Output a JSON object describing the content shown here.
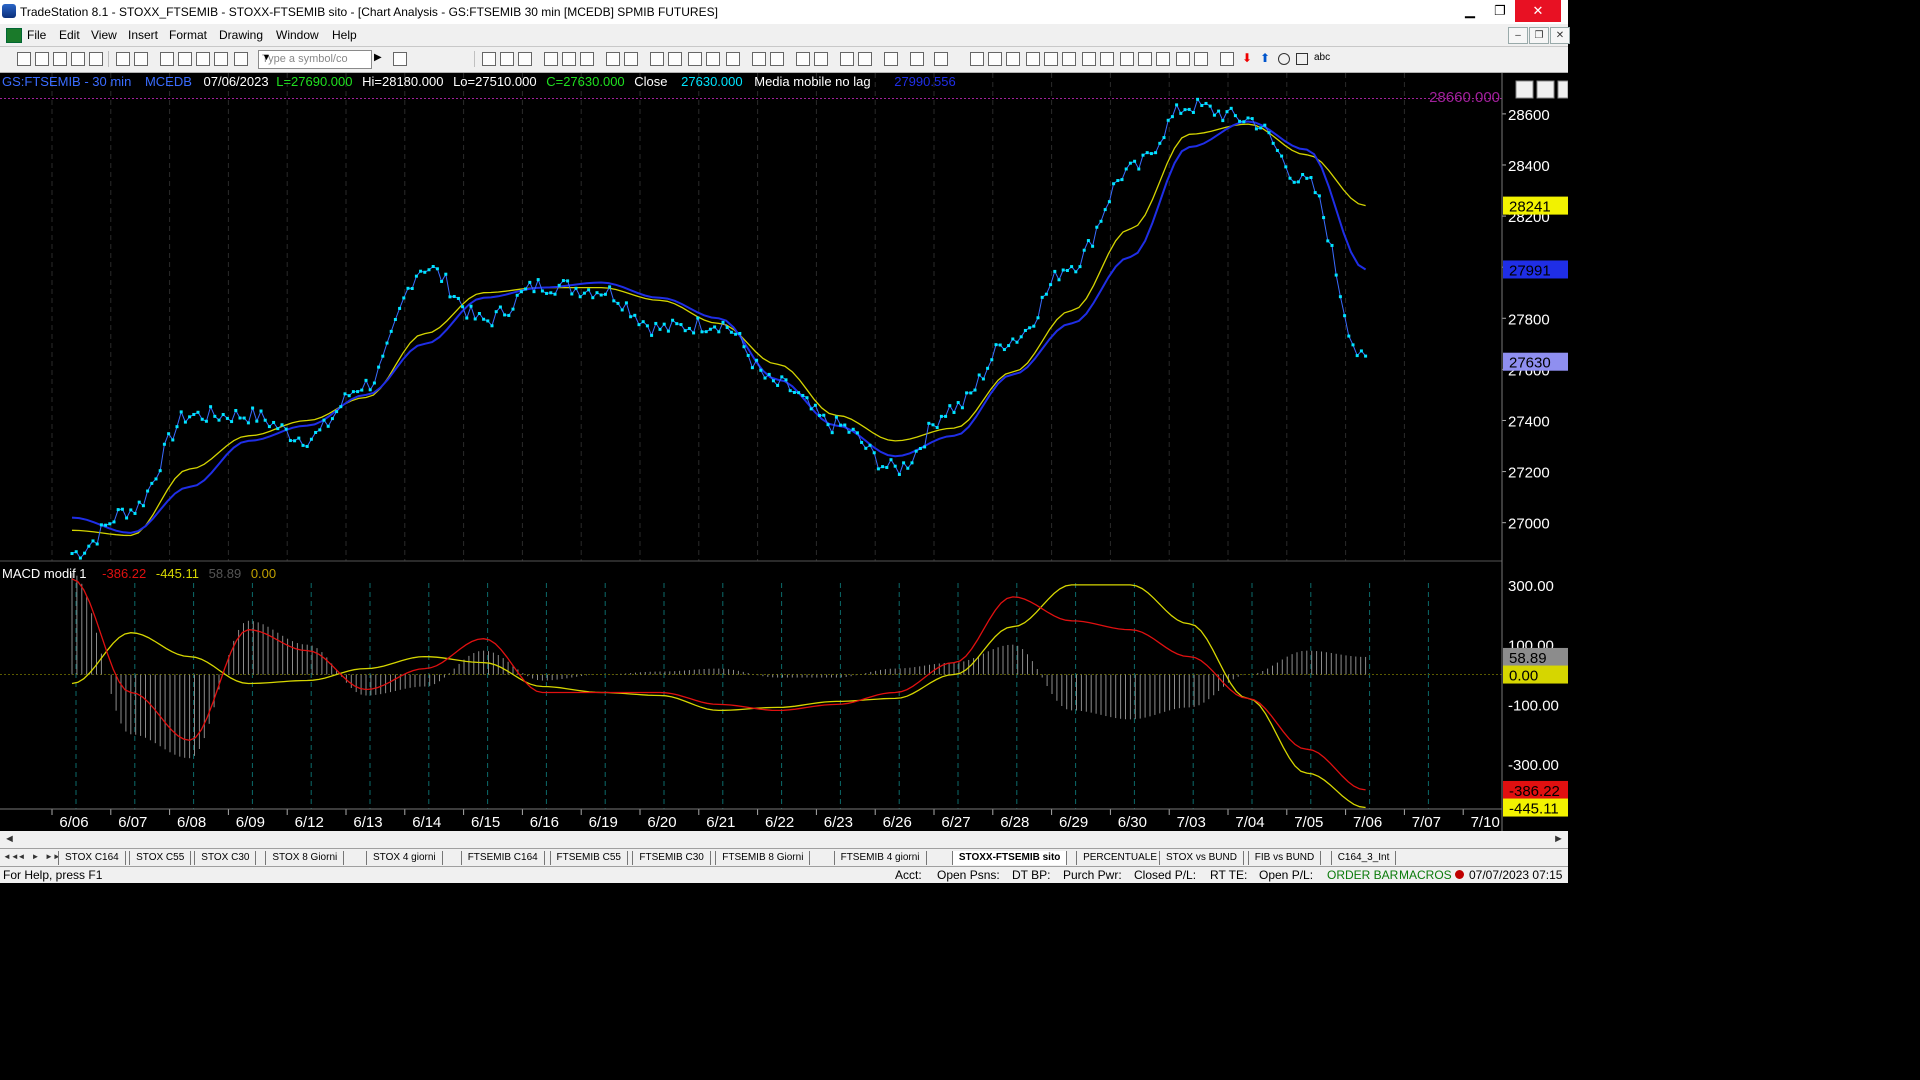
{
  "window": {
    "title": "TradeStation 8.1 - STOXX_FTSEMIB - STOXX-FTSEMIB sito - [Chart Analysis - GS:FTSEMIB  30 min  [MCEDB] SPMIB FUTURES]",
    "minimize": "▁",
    "maximize": "❐",
    "close": "✕"
  },
  "menu": {
    "items": [
      "File",
      "Edit",
      "View",
      "Insert",
      "Format",
      "Drawing",
      "Window",
      "Help"
    ],
    "mdi_buttons": [
      "–",
      "❐",
      "✕"
    ]
  },
  "toolbar": {
    "symbol_placeholder": "Type a symbol/co",
    "text_tool": "abc"
  },
  "chart": {
    "header": {
      "symbol": "GS:FTSEMIB - 30 min",
      "feed": "MCEDB",
      "date": "07/06/2023",
      "low_left": "L=27690.000",
      "high": "Hi=28180.000",
      "low": "Lo=27510.000",
      "close_eq": "C=27630.000",
      "close_label": "Close",
      "close_value": "27630.000",
      "indicator_name": "Media mobile no lag",
      "indicator_value": "27990.556"
    },
    "colors": {
      "background": "#000000",
      "price": "#00e5ff",
      "fast_ma": "#d4d400",
      "slow_ma": "#1f2ee6",
      "macd": "#e01010",
      "signal": "#d6d600",
      "histogram": "#8c8c8c",
      "level": "#a0209a"
    },
    "h_level": {
      "value": 28660,
      "label": "28660.000"
    },
    "price_ticks": [
      {
        "v": 28600,
        "label": "28600"
      },
      {
        "v": 28400,
        "label": "28400"
      },
      {
        "v": 28200,
        "label": "28200"
      },
      {
        "v": 28000,
        "label": "28000"
      },
      {
        "v": 27800,
        "label": "27800"
      },
      {
        "v": 27600,
        "label": "27600"
      },
      {
        "v": 27400,
        "label": "27400"
      },
      {
        "v": 27200,
        "label": "27200"
      },
      {
        "v": 27000,
        "label": "27000"
      }
    ],
    "price_tags": [
      {
        "v": 28241,
        "label": "28241",
        "bg": "#f2f200",
        "fg": "#000"
      },
      {
        "v": 27991,
        "label": "27991",
        "bg": "#1f2ee6",
        "fg": "#000"
      },
      {
        "v": 27630,
        "label": "27630",
        "bg": "#8f8ff0",
        "fg": "#000"
      }
    ],
    "macd_header": {
      "name": "MACD modif 1",
      "macd_value": "-386.22",
      "signal_value": "-445.11",
      "hist_value": "58.89",
      "zero_value": "0.00"
    },
    "macd_ticks": [
      {
        "v": 300,
        "label": "300.00"
      },
      {
        "v": 100,
        "label": "100.00"
      },
      {
        "v": -100,
        "label": "-100.00"
      },
      {
        "v": -300,
        "label": "-300.00"
      }
    ],
    "macd_tags": [
      {
        "v": 58.89,
        "label": "58.89",
        "bg": "#8c8c8c",
        "fg": "#000"
      },
      {
        "v": 0,
        "label": "0.00",
        "bg": "#d6d600",
        "fg": "#000"
      },
      {
        "v": -386.22,
        "label": "-386.22",
        "bg": "#e01010",
        "fg": "#000"
      },
      {
        "v": -445.11,
        "label": "-445.11",
        "bg": "#f2f200",
        "fg": "#000"
      }
    ],
    "dates": [
      "6/06",
      "6/07",
      "6/08",
      "6/09",
      "6/12",
      "6/13",
      "6/14",
      "6/15",
      "6/16",
      "6/19",
      "6/20",
      "6/21",
      "6/22",
      "6/23",
      "6/26",
      "6/27",
      "6/28",
      "6/29",
      "6/30",
      "7/03",
      "7/04",
      "7/05",
      "7/06",
      "7/07",
      "7/10"
    ]
  },
  "chart_data": [
    {
      "type": "line",
      "title": "GS:FTSEMIB - 30 min",
      "xlabel": "",
      "ylabel": "",
      "ylim": [
        26850,
        28760
      ],
      "x": [
        "6/06",
        "6/07",
        "6/08",
        "6/09",
        "6/12",
        "6/13",
        "6/14",
        "6/15",
        "6/16",
        "6/19",
        "6/20",
        "6/21",
        "6/22",
        "6/23",
        "6/26",
        "6/27",
        "6/28",
        "6/29",
        "6/30",
        "7/03",
        "7/04",
        "7/05",
        "7/06"
      ],
      "series": [
        {
          "name": "Close",
          "values": [
            26880,
            27050,
            27420,
            27420,
            27330,
            27540,
            28000,
            27790,
            27930,
            27910,
            27760,
            27780,
            27540,
            27380,
            27210,
            27450,
            27720,
            28010,
            28380,
            28630,
            28580,
            28330,
            27630
          ]
        },
        {
          "name": "Media mobile no lag",
          "values": [
            26970,
            26950,
            27210,
            27340,
            27400,
            27490,
            27740,
            27900,
            27920,
            27920,
            27870,
            27780,
            27620,
            27420,
            27320,
            27370,
            27590,
            27830,
            28150,
            28520,
            28560,
            28440,
            28241
          ]
        },
        {
          "name": "",
          "values": [
            27020,
            26960,
            27140,
            27320,
            27380,
            27500,
            27700,
            27880,
            27920,
            27940,
            27880,
            27800,
            27560,
            27380,
            27260,
            27340,
            27580,
            27780,
            28040,
            28470,
            28570,
            28460,
            27991
          ]
        }
      ]
    },
    {
      "type": "line",
      "title": "MACD modif 1",
      "xlabel": "",
      "ylabel": "",
      "ylim": [
        -450,
        380
      ],
      "x": [
        "6/06",
        "6/07",
        "6/08",
        "6/09",
        "6/12",
        "6/13",
        "6/14",
        "6/15",
        "6/16",
        "6/19",
        "6/20",
        "6/21",
        "6/22",
        "6/23",
        "6/26",
        "6/27",
        "6/28",
        "6/29",
        "6/30",
        "7/03",
        "7/04",
        "7/05",
        "7/06"
      ],
      "series": [
        {
          "name": "MACD",
          "values": [
            320,
            -60,
            -220,
            150,
            80,
            -50,
            20,
            120,
            -60,
            -60,
            -60,
            -100,
            -120,
            -100,
            -60,
            40,
            260,
            180,
            150,
            60,
            -80,
            -250,
            -386.22
          ]
        },
        {
          "name": "Signal",
          "values": [
            -30,
            140,
            60,
            -30,
            -20,
            20,
            60,
            40,
            -40,
            -60,
            -70,
            -120,
            -110,
            -90,
            -80,
            0,
            160,
            300,
            300,
            170,
            -80,
            -330,
            -445.11
          ]
        },
        {
          "name": "Histogram",
          "values": [
            340,
            -200,
            -280,
            180,
            100,
            -70,
            -40,
            80,
            -20,
            0,
            10,
            20,
            -10,
            -10,
            20,
            40,
            100,
            -120,
            -150,
            -110,
            0,
            80,
            58.89
          ]
        }
      ]
    }
  ],
  "tabs": {
    "items": [
      "STOX C164",
      "STOX C55",
      "STOX  C30",
      "STOX  8 Giorni",
      "STOX 4 giorni",
      "FTSEMIB C164",
      "FTSEMIB C55",
      "FTSEMIB C30",
      "FTSEMIB  8 Giorni",
      "FTSEMIB  4 giorni",
      "STOXX-FTSEMIB sito",
      "PERCENTUALE",
      "STOX vs BUND",
      "FIB vs BUND",
      "C164_3_Int"
    ],
    "active": 10,
    "nav": [
      "◄◄",
      "◄",
      "►",
      "►►"
    ]
  },
  "status": {
    "help": "For Help, press F1",
    "acct": "Acct:",
    "open_psns": "Open Psns:",
    "dt_bp": "DT BP:",
    "purch_pwr": "Purch Pwr:",
    "closed_pl": "Closed P/L:",
    "rt_te": "RT TE:",
    "open_pl": "Open P/L:",
    "order_bar": "ORDER BAR",
    "macros": "MACROS",
    "datetime": "07/07/2023 07:15"
  }
}
